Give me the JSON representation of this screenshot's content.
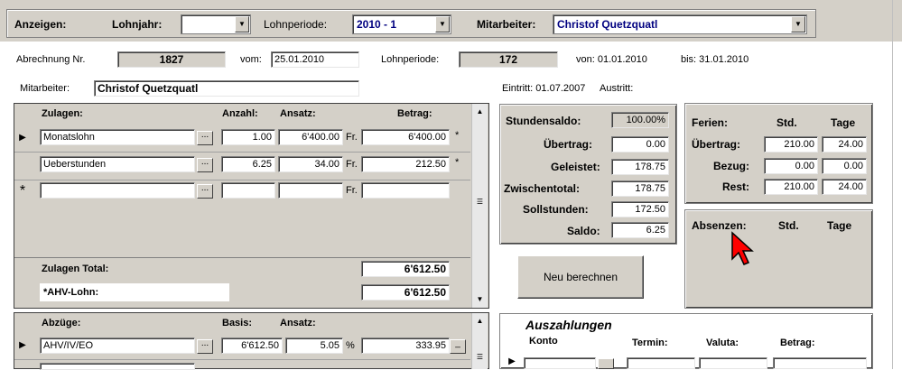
{
  "toolbar": {
    "anzeigen_label": "Anzeigen:",
    "lohnjahr_label": "Lohnjahr:",
    "lohnjahr_value": "",
    "lohnperiode_label": "Lohnperiode:",
    "lohnperiode_value": "2010 - 1",
    "mitarbeiter_label": "Mitarbeiter:",
    "mitarbeiter_value": "Christof Quetzquatl"
  },
  "header": {
    "abrechnung_label": "Abrechnung Nr.",
    "abrechnung_value": "1827",
    "vom_label": "vom:",
    "vom_value": "25.01.2010",
    "lohnperiode_label": "Lohnperiode:",
    "lohnperiode_value": "172",
    "von_text": "von: 01.01.2010",
    "bis_text": "bis: 31.01.2010",
    "mitarbeiter_label": "Mitarbeiter:",
    "mitarbeiter_value": "Christof Quetzquatl",
    "eintritt_text": "Eintritt: 01.07.2007",
    "austritt_text": "Austritt:"
  },
  "zulagen": {
    "col_zulagen": "Zulagen:",
    "col_anzahl": "Anzahl:",
    "col_ansatz": "Ansatz:",
    "col_betrag": "Betrag:",
    "rows": [
      {
        "name": "Monatslohn",
        "anzahl": "1.00",
        "ansatz": "6'400.00",
        "unit": "Fr.",
        "betrag": "6'400.00",
        "flag": "*"
      },
      {
        "name": "Ueberstunden",
        "anzahl": "6.25",
        "ansatz": "34.00",
        "unit": "Fr.",
        "betrag": "212.50",
        "flag": "*"
      },
      {
        "name": "",
        "anzahl": "",
        "ansatz": "",
        "unit": "Fr.",
        "betrag": "",
        "flag": ""
      }
    ],
    "total_label": "Zulagen Total:",
    "total_value": "6'612.50",
    "ahv_label": "*AHV-Lohn:",
    "ahv_value": "6'612.50"
  },
  "abzuege": {
    "col_abzuege": "Abzüge:",
    "col_basis": "Basis:",
    "col_ansatz": "Ansatz:",
    "rows": [
      {
        "name": "AHV/IV/EO",
        "basis": "6'612.50",
        "ansatz": "5.05",
        "unit": "%",
        "betrag": "333.95"
      }
    ]
  },
  "stunden": {
    "stundensaldo_label": "Stundensaldo:",
    "stundensaldo_value": "100.00%",
    "uebertrag_label": "Übertrag:",
    "uebertrag_value": "0.00",
    "geleistet_label": "Geleistet:",
    "geleistet_value": "178.75",
    "zwischentotal_label": "Zwischentotal:",
    "zwischentotal_value": "178.75",
    "sollstunden_label": "Sollstunden:",
    "sollstunden_value": "172.50",
    "saldo_label": "Saldo:",
    "saldo_value": "6.25"
  },
  "ferien": {
    "ferien_label": "Ferien:",
    "std_label": "Std.",
    "tage_label": "Tage",
    "uebertrag_label": "Übertrag:",
    "uebertrag_std": "210.00",
    "uebertrag_tage": "24.00",
    "bezug_label": "Bezug:",
    "bezug_std": "0.00",
    "bezug_tage": "0.00",
    "rest_label": "Rest:",
    "rest_std": "210.00",
    "rest_tage": "24.00"
  },
  "absenzen": {
    "label": "Absenzen:",
    "std_label": "Std.",
    "tage_label": "Tage"
  },
  "neu_berechnen_label": "Neu berechnen",
  "auszahlungen": {
    "title": "Auszahlungen",
    "col_konto": "Konto",
    "col_termin": "Termin:",
    "col_valuta": "Valuta:",
    "col_betrag": "Betrag:"
  }
}
